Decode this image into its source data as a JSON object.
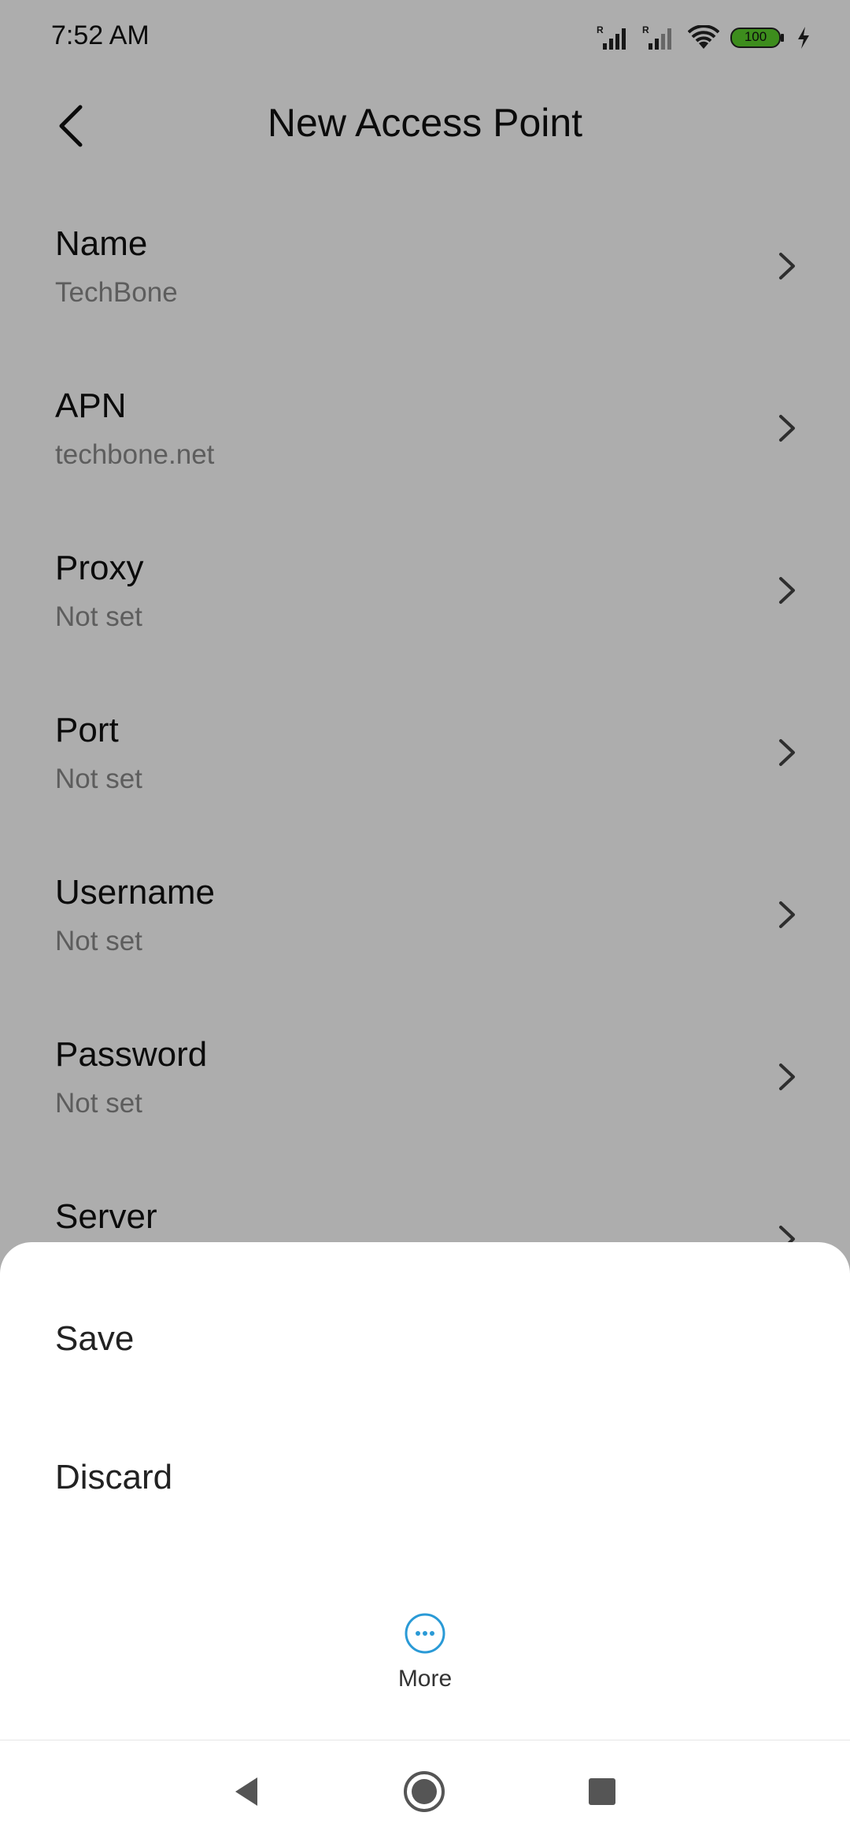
{
  "status_bar": {
    "time": "7:52 AM",
    "battery": "100",
    "icons": [
      "signal-roaming-icon",
      "signal-roaming-icon",
      "wifi-icon",
      "battery-icon",
      "charging-icon"
    ]
  },
  "app_bar": {
    "title": "New Access Point",
    "back_icon": "back-arrow-icon"
  },
  "settings": {
    "items": [
      {
        "label": "Name",
        "value": "TechBone"
      },
      {
        "label": "APN",
        "value": "techbone.net"
      },
      {
        "label": "Proxy",
        "value": "Not set"
      },
      {
        "label": "Port",
        "value": "Not set"
      },
      {
        "label": "Username",
        "value": "Not set"
      },
      {
        "label": "Password",
        "value": "Not set"
      },
      {
        "label": "Server",
        "value": ""
      }
    ]
  },
  "sheet": {
    "save_label": "Save",
    "discard_label": "Discard",
    "more_label": "More",
    "accent_color": "#2a9ad6"
  },
  "nav_bar": {
    "icons": [
      "back-triangle-icon",
      "home-circle-icon",
      "recents-square-icon"
    ]
  }
}
